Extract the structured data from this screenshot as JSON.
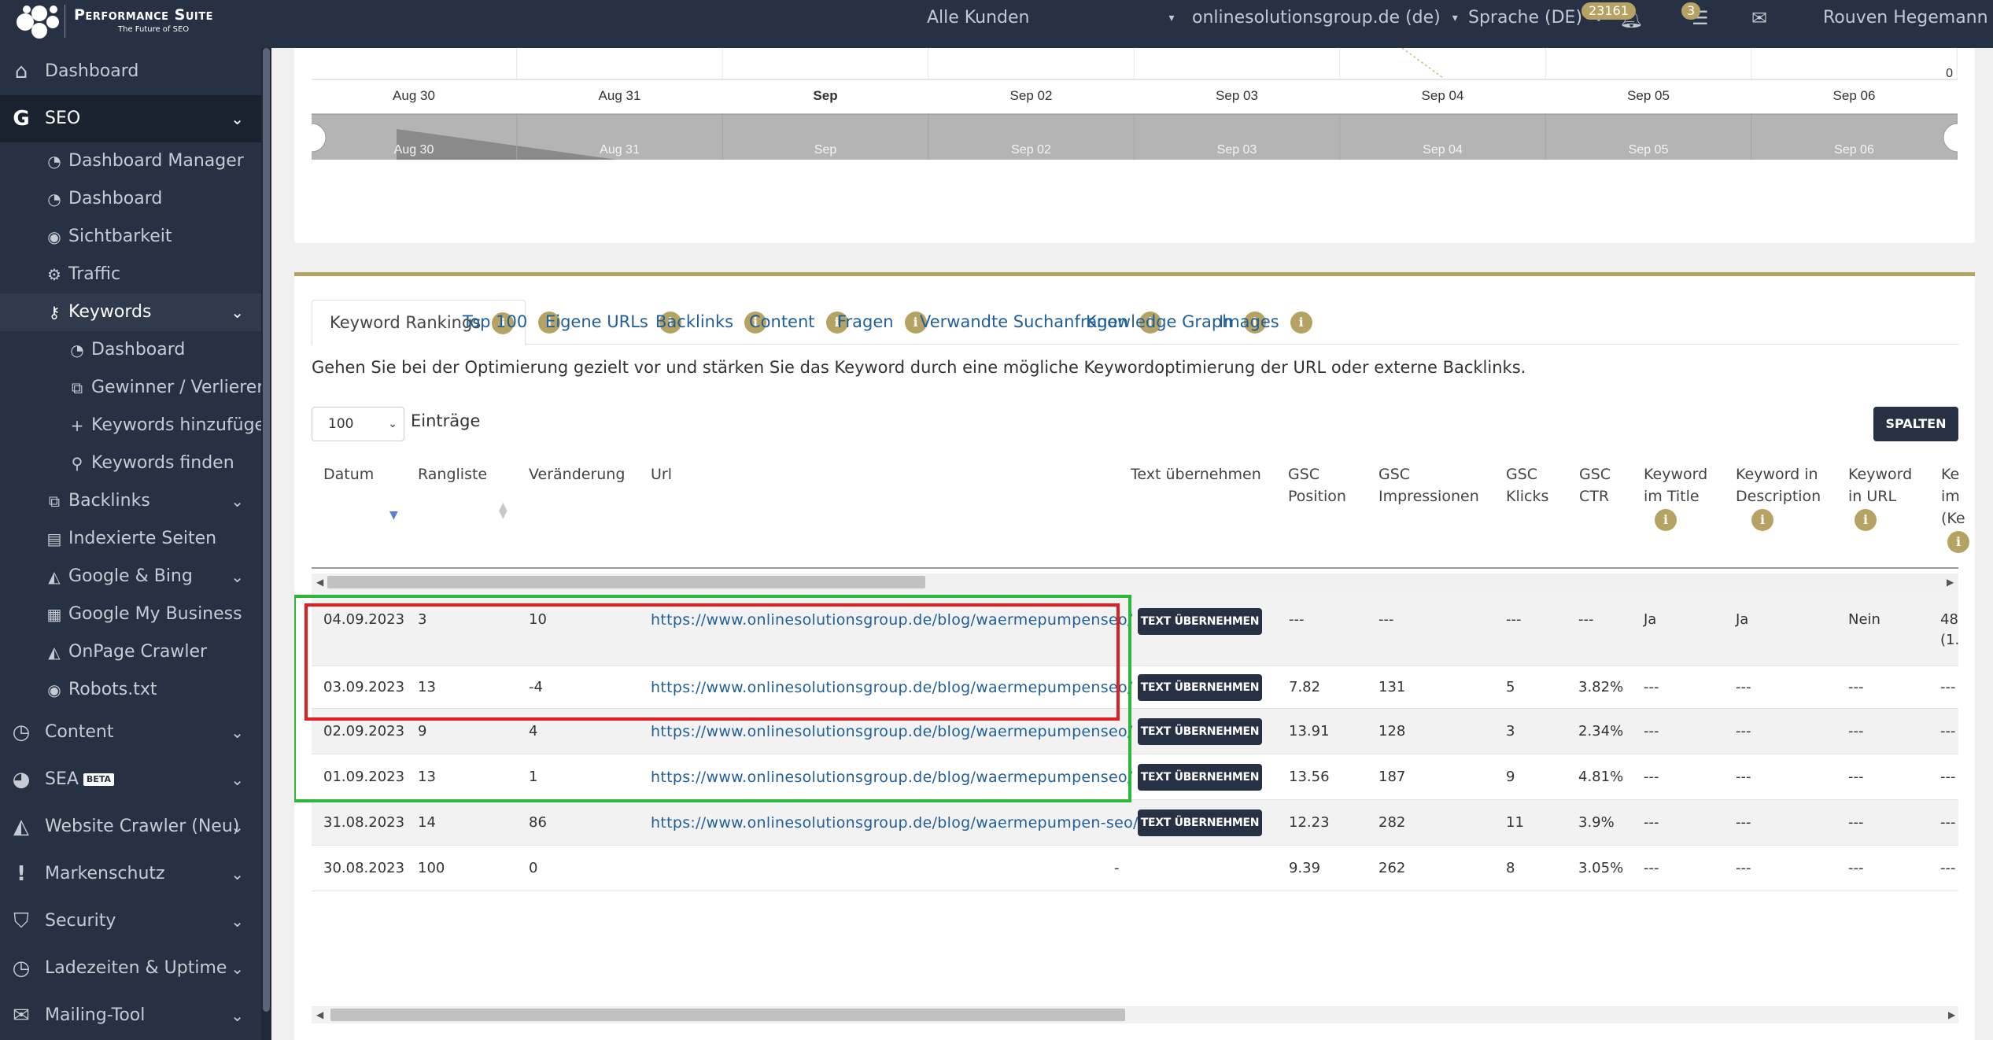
{
  "app": {
    "brand_name": "Performance Suite",
    "brand_tagline": "The Future of SEO"
  },
  "topbar": {
    "customers": "Alle Kunden",
    "domain": "onlinesolutionsgroup.de (de)",
    "language": "Sprache (DE)",
    "notifications_count": "23161",
    "tasks_count": "3",
    "user_name": "Rouven Hegemann"
  },
  "sidebar": {
    "items": [
      {
        "label": "Dashboard",
        "icon": "home-icon"
      },
      {
        "label": "SEO",
        "icon": "google-g-icon"
      },
      {
        "label": "Dashboard Manager",
        "icon": "tachometer-icon"
      },
      {
        "label": "Dashboard",
        "icon": "tachometer-icon"
      },
      {
        "label": "Sichtbarkeit",
        "icon": "eye-icon"
      },
      {
        "label": "Traffic",
        "icon": "cogs-icon"
      },
      {
        "label": "Keywords",
        "icon": "key-icon"
      },
      {
        "label": "Dashboard",
        "icon": "tachometer-icon"
      },
      {
        "label": "Gewinner / Verlierer",
        "icon": "external-link-icon"
      },
      {
        "label": "Keywords hinzufügen",
        "icon": "plus-icon"
      },
      {
        "label": "Keywords finden",
        "icon": "search-icon"
      },
      {
        "label": "Backlinks",
        "icon": "external-link-icon"
      },
      {
        "label": "Indexierte Seiten",
        "icon": "file-icon"
      },
      {
        "label": "Google & Bing",
        "icon": "area-chart-icon"
      },
      {
        "label": "Google My Business",
        "icon": "store-icon"
      },
      {
        "label": "OnPage Crawler",
        "icon": "area-chart-icon"
      },
      {
        "label": "Robots.txt",
        "icon": "eye-icon"
      },
      {
        "label": "Content",
        "icon": "clock-icon"
      },
      {
        "label": "SEA",
        "icon": "pie-chart-icon",
        "badge": "BETA"
      },
      {
        "label": "Website Crawler (Neu)",
        "icon": "area-chart-icon"
      },
      {
        "label": "Markenschutz",
        "icon": "exclamation-icon"
      },
      {
        "label": "Security",
        "icon": "shield-icon"
      },
      {
        "label": "Ladezeiten & Uptime",
        "icon": "clock-icon"
      },
      {
        "label": "Mailing-Tool",
        "icon": "envelope-icon"
      }
    ]
  },
  "chart": {
    "x_labels": [
      "Aug 30",
      "Aug 31",
      "Sep",
      "Sep 02",
      "Sep 03",
      "Sep 04",
      "Sep 05",
      "Sep 06"
    ],
    "y_right_label": "0",
    "navigator_labels": [
      "Aug 30",
      "Aug 31",
      "Sep",
      "Sep 02",
      "Sep 03",
      "Sep 04",
      "Sep 05",
      "Sep 06"
    ]
  },
  "tabs": [
    {
      "label": "Keyword Rankings",
      "active": true
    },
    {
      "label": "Top 100"
    },
    {
      "label": "Eigene URLs"
    },
    {
      "label": "Backlinks"
    },
    {
      "label": "Content"
    },
    {
      "label": "Fragen"
    },
    {
      "label": "Verwandte Suchanfragen"
    },
    {
      "label": "Knowledge Graph"
    },
    {
      "label": "Images"
    }
  ],
  "hint_text": "Gehen Sie bei der Optimierung gezielt vor und stärken Sie das Keyword durch eine mögliche Keywordoptimierung der URL oder externe Backlinks.",
  "controls": {
    "entries_value": "100",
    "entries_label": "Einträge",
    "columns_button": "SPALTEN"
  },
  "table": {
    "columns": [
      {
        "l1": "Datum",
        "l2": ""
      },
      {
        "l1": "Rangliste",
        "l2": ""
      },
      {
        "l1": "Veränderung",
        "l2": ""
      },
      {
        "l1": "Url",
        "l2": ""
      },
      {
        "l1": "Text übernehmen",
        "l2": ""
      },
      {
        "l1": "GSC",
        "l2": "Position"
      },
      {
        "l1": "GSC",
        "l2": "Impressionen"
      },
      {
        "l1": "GSC",
        "l2": "Klicks"
      },
      {
        "l1": "GSC",
        "l2": "CTR"
      },
      {
        "l1": "Keyword",
        "l2": "im Title"
      },
      {
        "l1": "Keyword in",
        "l2": "Description"
      },
      {
        "l1": "Keyword",
        "l2": "in URL"
      },
      {
        "l1": "Ke",
        "l2": "im",
        "l3": "(Ke"
      }
    ],
    "button_label": "TEXT ÜBERNEHMEN",
    "rows": [
      {
        "date": "04.09.2023",
        "rank": "3",
        "change": "10",
        "url": "https://www.onlinesolutionsgroup.de/blog/waermepumpenseo/",
        "text": "",
        "gsc_pos": "---",
        "gsc_impr": "---",
        "gsc_clicks": "---",
        "gsc_ctr": "---",
        "kw_title": "Ja",
        "kw_desc": "Ja",
        "kw_url": "Nein",
        "extra": "48",
        "extra2": "(1.",
        "has_button": true
      },
      {
        "date": "03.09.2023",
        "rank": "13",
        "change": "-4",
        "url": "https://www.onlinesolutionsgroup.de/blog/waermepumpenseo/",
        "text": "",
        "gsc_pos": "7.82",
        "gsc_impr": "131",
        "gsc_clicks": "5",
        "gsc_ctr": "3.82%",
        "kw_title": "---",
        "kw_desc": "---",
        "kw_url": "---",
        "extra": "---",
        "has_button": true
      },
      {
        "date": "02.09.2023",
        "rank": "9",
        "change": "4",
        "url": "https://www.onlinesolutionsgroup.de/blog/waermepumpenseo/",
        "text": "",
        "gsc_pos": "13.91",
        "gsc_impr": "128",
        "gsc_clicks": "3",
        "gsc_ctr": "2.34%",
        "kw_title": "---",
        "kw_desc": "---",
        "kw_url": "---",
        "extra": "---",
        "has_button": true
      },
      {
        "date": "01.09.2023",
        "rank": "13",
        "change": "1",
        "url": "https://www.onlinesolutionsgroup.de/blog/waermepumpenseo/",
        "text": "",
        "gsc_pos": "13.56",
        "gsc_impr": "187",
        "gsc_clicks": "9",
        "gsc_ctr": "4.81%",
        "kw_title": "---",
        "kw_desc": "---",
        "kw_url": "---",
        "extra": "---",
        "has_button": true
      },
      {
        "date": "31.08.2023",
        "rank": "14",
        "change": "86",
        "url": "https://www.onlinesolutionsgroup.de/blog/waermepumpen-seo/",
        "text": "",
        "gsc_pos": "12.23",
        "gsc_impr": "282",
        "gsc_clicks": "11",
        "gsc_ctr": "3.9%",
        "kw_title": "---",
        "kw_desc": "---",
        "kw_url": "---",
        "extra": "---",
        "has_button": true
      },
      {
        "date": "30.08.2023",
        "rank": "100",
        "change": "0",
        "url": "",
        "text": "-",
        "gsc_pos": "9.39",
        "gsc_impr": "262",
        "gsc_clicks": "8",
        "gsc_ctr": "3.05%",
        "kw_title": "---",
        "kw_desc": "---",
        "kw_url": "---",
        "extra": "---",
        "has_button": false
      }
    ]
  },
  "colors": {
    "navy": "#263143",
    "gold": "#b6a363",
    "link": "#1f5f99",
    "highlight_red": "#e02020",
    "highlight_green": "#2bb83a"
  }
}
